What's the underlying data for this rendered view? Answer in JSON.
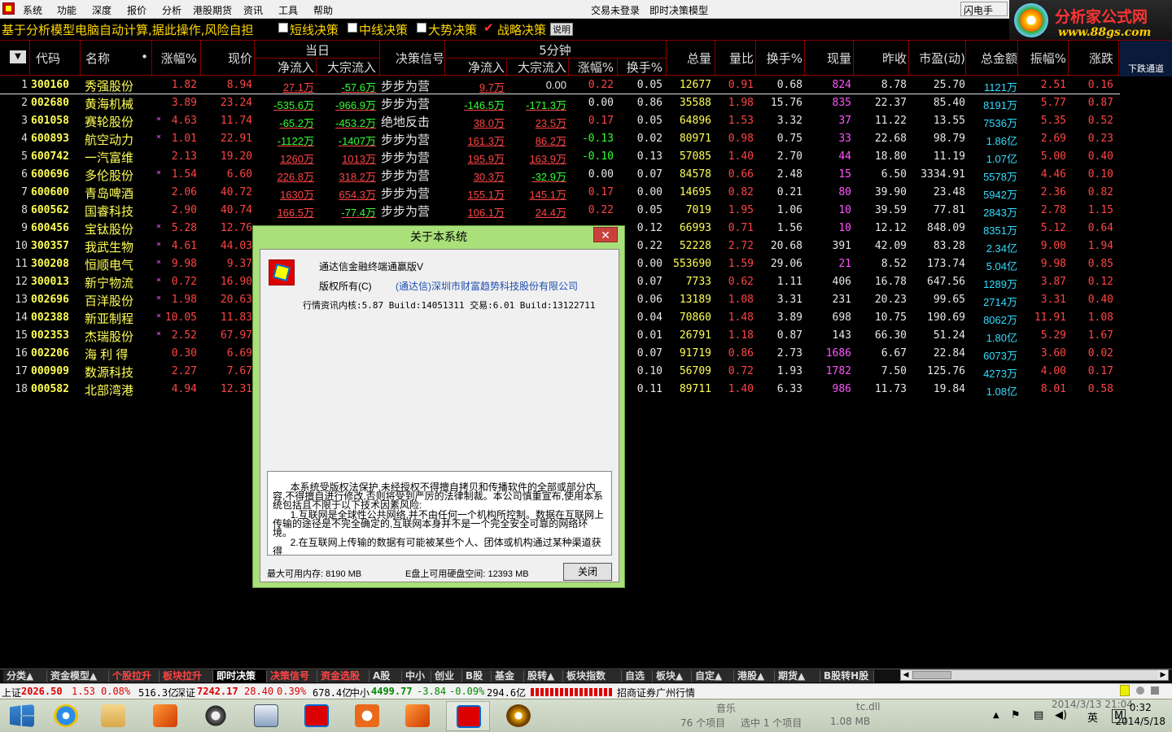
{
  "menu": {
    "items": [
      "系统",
      "功能",
      "深度",
      "报价",
      "分析",
      "港股期货",
      "资讯",
      "工具",
      "帮助"
    ],
    "center1": "交易未登录",
    "center2": "即时决策模型",
    "right1": "闪电手",
    "right2": "行"
  },
  "brand": {
    "title": "分析家公式网",
    "url": "www.88gs.com"
  },
  "toolbar": {
    "slogan": "基于分析模型电脑自动计算,据此操作,风险自担",
    "opt1": "短线决策",
    "opt2": "中线决策",
    "opt3": "大势决策",
    "opt4": "战略决策",
    "help": "说明"
  },
  "header": {
    "dropdown": "▼",
    "code": "代码",
    "name": "名称",
    "dot": "•",
    "change": "涨幅%",
    "price": "现价",
    "today": "当日",
    "today_net": "净流入",
    "today_big": "大宗流入",
    "signal": "决策信号",
    "five": "5分钟",
    "five_net": "净流入",
    "five_big": "大宗流入",
    "five_change": "涨幅%",
    "five_turn": "换手%",
    "volume": "总量",
    "ratio": "量比",
    "turnover": "换手%",
    "current": "现量",
    "prev": "昨收",
    "pe": "市盈(动)",
    "amount": "总金额",
    "amplitude": "振幅%",
    "diff": "涨跌",
    "channel": "下跌通道"
  },
  "rows": [
    {
      "i": "1",
      "code": "300160",
      "name": "秀强股份",
      "x": "",
      "chg": "1.82",
      "price": "8.94",
      "net": "27.1万",
      "big": "-57.6万",
      "sig": "步步为营",
      "fnet": "9.7万",
      "fbig": "0.00",
      "fchg": "0.22",
      "fturn": "0.05",
      "vol": "12677",
      "ratio": "0.91",
      "turn": "0.68",
      "cur": "824",
      "prev": "8.78",
      "pe": "25.70",
      "amt": "1121万",
      "amp": "2.51",
      "diff": "0.16"
    },
    {
      "i": "2",
      "code": "002680",
      "name": "黄海机械",
      "x": "",
      "chg": "3.89",
      "price": "23.24",
      "net": "-535.6万",
      "big": "-966.9万",
      "sig": "步步为营",
      "fnet": "-146.5万",
      "fbig": "-171.3万",
      "fchg": "0.00",
      "fturn": "0.86",
      "vol": "35588",
      "ratio": "1.98",
      "turn": "15.76",
      "cur": "835",
      "prev": "22.37",
      "pe": "85.40",
      "amt": "8191万",
      "amp": "5.77",
      "diff": "0.87"
    },
    {
      "i": "3",
      "code": "601058",
      "name": "赛轮股份",
      "x": "×",
      "chg": "4.63",
      "price": "11.74",
      "net": "-65.2万",
      "big": "-453.2万",
      "sig": "绝地反击",
      "fnet": "38.0万",
      "fbig": "23.5万",
      "fchg": "0.17",
      "fturn": "0.05",
      "vol": "64896",
      "ratio": "1.53",
      "turn": "3.32",
      "cur": "37",
      "prev": "11.22",
      "pe": "13.55",
      "amt": "7536万",
      "amp": "5.35",
      "diff": "0.52"
    },
    {
      "i": "4",
      "code": "600893",
      "name": "航空动力",
      "x": "×",
      "chg": "1.01",
      "price": "22.91",
      "net": "-1122万",
      "big": "-1407万",
      "sig": "步步为营",
      "fnet": "161.3万",
      "fbig": "86.2万",
      "fchg": "-0.13",
      "fturn": "0.02",
      "vol": "80971",
      "ratio": "0.98",
      "turn": "0.75",
      "cur": "33",
      "prev": "22.68",
      "pe": "98.79",
      "amt": "1.86亿",
      "amp": "2.69",
      "diff": "0.23"
    },
    {
      "i": "5",
      "code": "600742",
      "name": "一汽富维",
      "x": "",
      "chg": "2.13",
      "price": "19.20",
      "net": "1260万",
      "big": "1013万",
      "sig": "步步为营",
      "fnet": "195.9万",
      "fbig": "163.9万",
      "fchg": "-0.10",
      "fturn": "0.13",
      "vol": "57085",
      "ratio": "1.40",
      "turn": "2.70",
      "cur": "44",
      "prev": "18.80",
      "pe": "11.19",
      "amt": "1.07亿",
      "amp": "5.00",
      "diff": "0.40"
    },
    {
      "i": "6",
      "code": "600696",
      "name": "多伦股份",
      "x": "×",
      "chg": "1.54",
      "price": "6.60",
      "net": "226.8万",
      "big": "318.2万",
      "sig": "步步为营",
      "fnet": "30.3万",
      "fbig": "-32.9万",
      "fchg": "0.00",
      "fturn": "0.07",
      "vol": "84578",
      "ratio": "0.66",
      "turn": "2.48",
      "cur": "15",
      "prev": "6.50",
      "pe": "3334.91",
      "amt": "5578万",
      "amp": "4.46",
      "diff": "0.10"
    },
    {
      "i": "7",
      "code": "600600",
      "name": "青岛啤酒",
      "x": "",
      "chg": "2.06",
      "price": "40.72",
      "net": "1630万",
      "big": "654.3万",
      "sig": "步步为营",
      "fnet": "155.1万",
      "fbig": "145.1万",
      "fchg": "0.17",
      "fturn": "0.00",
      "vol": "14695",
      "ratio": "0.82",
      "turn": "0.21",
      "cur": "80",
      "prev": "39.90",
      "pe": "23.48",
      "amt": "5942万",
      "amp": "2.36",
      "diff": "0.82"
    },
    {
      "i": "8",
      "code": "600562",
      "name": "国睿科技",
      "x": "",
      "chg": "2.90",
      "price": "40.74",
      "net": "166.5万",
      "big": "-77.4万",
      "sig": "步步为营",
      "fnet": "106.1万",
      "fbig": "24.4万",
      "fchg": "0.22",
      "fturn": "0.05",
      "vol": "7019",
      "ratio": "1.95",
      "turn": "1.06",
      "cur": "10",
      "prev": "39.59",
      "pe": "77.81",
      "amt": "2843万",
      "amp": "2.78",
      "diff": "1.15"
    },
    {
      "i": "9",
      "code": "600456",
      "name": "宝钛股份",
      "x": "×",
      "chg": "5.28",
      "price": "12.76",
      "fturn": "0.12",
      "vol": "66993",
      "ratio": "0.71",
      "turn": "1.56",
      "cur": "10",
      "prev": "12.12",
      "pe": "848.09",
      "amt": "8351万",
      "amp": "5.12",
      "diff": "0.64"
    },
    {
      "i": "10",
      "code": "300357",
      "name": "我武生物",
      "x": "×",
      "chg": "4.61",
      "price": "44.03",
      "fturn": "0.22",
      "vol": "52228",
      "ratio": "2.72",
      "turn": "20.68",
      "cur": "391",
      "prev": "42.09",
      "pe": "83.28",
      "amt": "2.34亿",
      "amp": "9.00",
      "diff": "1.94"
    },
    {
      "i": "11",
      "code": "300208",
      "name": "恒顺电气",
      "x": "×",
      "chg": "9.98",
      "price": "9.37",
      "fturn": "0.00",
      "vol": "553690",
      "ratio": "1.59",
      "turn": "29.06",
      "cur": "21",
      "prev": "8.52",
      "pe": "173.74",
      "amt": "5.04亿",
      "amp": "9.98",
      "diff": "0.85"
    },
    {
      "i": "12",
      "code": "300013",
      "name": "新宁物流",
      "x": "×",
      "chg": "0.72",
      "price": "16.90",
      "fturn": "0.07",
      "vol": "7733",
      "ratio": "0.62",
      "turn": "1.11",
      "cur": "406",
      "prev": "16.78",
      "pe": "647.56",
      "amt": "1289万",
      "amp": "3.87",
      "diff": "0.12"
    },
    {
      "i": "13",
      "code": "002696",
      "name": "百洋股份",
      "x": "×",
      "chg": "1.98",
      "price": "20.63",
      "fturn": "0.06",
      "vol": "13189",
      "ratio": "1.08",
      "turn": "3.31",
      "cur": "231",
      "prev": "20.23",
      "pe": "99.65",
      "amt": "2714万",
      "amp": "3.31",
      "diff": "0.40"
    },
    {
      "i": "14",
      "code": "002388",
      "name": "新亚制程",
      "x": "×",
      "chg": "10.05",
      "price": "11.83",
      "fturn": "0.04",
      "vol": "70860",
      "ratio": "1.48",
      "turn": "3.89",
      "cur": "698",
      "prev": "10.75",
      "pe": "190.69",
      "amt": "8062万",
      "amp": "11.91",
      "diff": "1.08"
    },
    {
      "i": "15",
      "code": "002353",
      "name": "杰瑞股份",
      "x": "×",
      "chg": "2.52",
      "price": "67.97",
      "fturn": "0.01",
      "vol": "26791",
      "ratio": "1.18",
      "turn": "0.87",
      "cur": "143",
      "prev": "66.30",
      "pe": "51.24",
      "amt": "1.80亿",
      "amp": "5.29",
      "diff": "1.67"
    },
    {
      "i": "16",
      "code": "002206",
      "name": "海 利 得",
      "x": "",
      "chg": "0.30",
      "price": "6.69",
      "fturn": "0.07",
      "vol": "91719",
      "ratio": "0.86",
      "turn": "2.73",
      "cur": "1686",
      "prev": "6.67",
      "pe": "22.84",
      "amt": "6073万",
      "amp": "3.60",
      "diff": "0.02"
    },
    {
      "i": "17",
      "code": "000909",
      "name": "数源科技",
      "x": "",
      "chg": "2.27",
      "price": "7.67",
      "fturn": "0.10",
      "vol": "56709",
      "ratio": "0.72",
      "turn": "1.93",
      "cur": "1782",
      "prev": "7.50",
      "pe": "125.76",
      "amt": "4273万",
      "amp": "4.00",
      "diff": "0.17"
    },
    {
      "i": "18",
      "code": "000582",
      "name": "北部湾港",
      "x": "",
      "chg": "4.94",
      "price": "12.31",
      "fturn": "0.11",
      "vol": "89711",
      "ratio": "1.40",
      "turn": "6.33",
      "cur": "986",
      "prev": "11.73",
      "pe": "19.84",
      "amt": "1.08亿",
      "amp": "8.01",
      "diff": "0.58"
    }
  ],
  "dialog": {
    "title": "关于本系统",
    "close": "✕",
    "product": "通达信金融终端通赢版V",
    "copyright_label": "版权所有(C)",
    "company": "(通达信)深圳市财富趋势科技股份有限公司",
    "version": "行情资讯内核:5.87 Build:14051311 交易:6.01 Build:13122711",
    "notice1": "本系统受版权法保护,未经授权不得擅自拷贝和传播软件的全部或部分内容,不得擅自进行修改,否则将受到严厉的法律制裁。本公司慎重宣布,使用本系统包括且不限于以下技术因素风险:",
    "notice2": "1.互联网是全球性公共网络,并不由任何一个机构所控制。数据在互联网上传输的途径是不完全确定的,互联网本身并不是一个完全安全可靠的网络环境。",
    "notice3": "2.在互联网上传输的数据有可能被某些个人、团体或机构通过某种渠道获得",
    "memory": "最大可用内存: 8190 MB",
    "disk": "E盘上可用硬盘空间: 12393 MB",
    "ok": "关闭"
  },
  "tabs": [
    "分类▲",
    "资金模型▲",
    "个股拉升",
    "板块拉升",
    "即时决策",
    "决策信号",
    "资金选股",
    "A股",
    "中小",
    "创业",
    "B股",
    "基金",
    "股转▲",
    "板块指数",
    "自选",
    "板块▲",
    "自定▲",
    "港股▲",
    "期货▲",
    "B股转H股"
  ],
  "status": {
    "sh_label": "上证",
    "sh_val": "2026.50",
    "sh_chg": "1.53",
    "sh_pct": "0.08%",
    "sh_amt": "516.3亿",
    "sz_label": "深证",
    "sz_val": "7242.17",
    "sz_chg": "28.40",
    "sz_pct": "0.39%",
    "sz_amt": "678.4亿",
    "zx_label": "中小",
    "zx_val": "4499.77",
    "zx_chg": "-3.84",
    "zx_pct": "-0.09%",
    "zx_amt": "294.6亿",
    "broker": "招商证券广州行情"
  },
  "taskbar": {
    "ghost1": "音乐",
    "ghost2": "tc.dll",
    "ghost3": "76 个项目",
    "ghost4": "选中 1 个项目",
    "ghost5": "1.08 MB",
    "ghost6": "2014/3/13 21:04",
    "ime": "英",
    "ime2": "M",
    "time": "0:32",
    "date": "2014/5/18"
  },
  "colors": {
    "up": "#ff4444",
    "down": "#33ff33",
    "code": "#ffff55",
    "amount": "#33ddff",
    "curvol": "#ff55ff"
  }
}
